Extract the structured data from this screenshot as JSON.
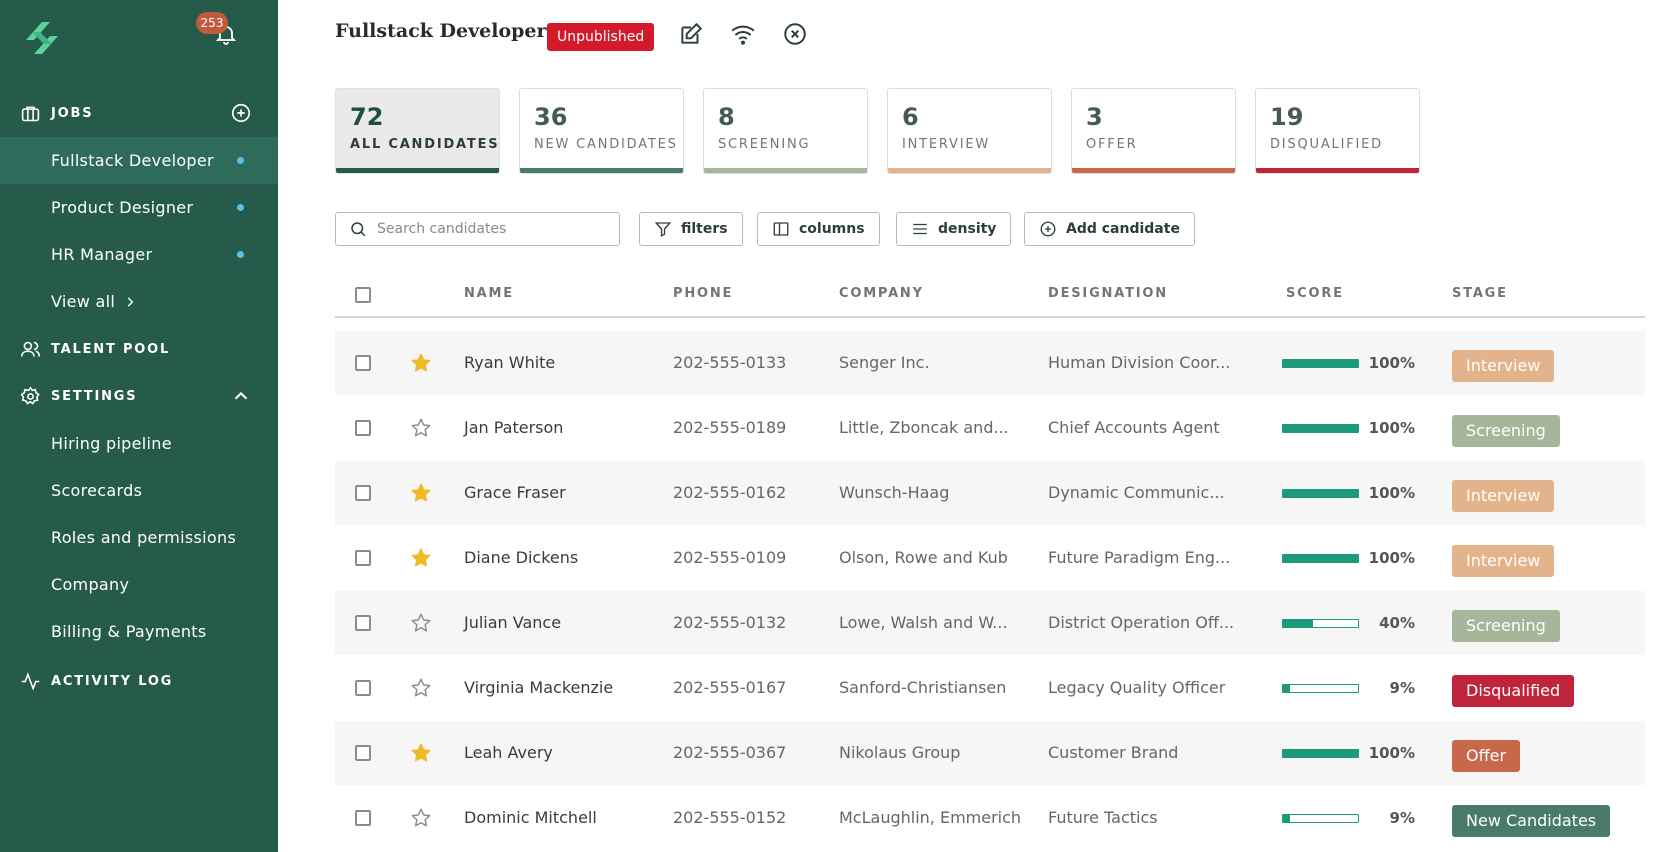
{
  "sidebar": {
    "notification_count": "253",
    "jobs_label": "JOBS",
    "jobs": [
      {
        "label": "Fullstack Developer",
        "active": true
      },
      {
        "label": "Product Designer",
        "active": false
      },
      {
        "label": "HR Manager",
        "active": false
      }
    ],
    "view_all": "View all",
    "talent_pool": "TALENT POOL",
    "settings_label": "SETTINGS",
    "settings_items": [
      "Hiring pipeline",
      "Scorecards",
      "Roles and permissions",
      "Company",
      "Billing & Payments"
    ],
    "activity_log": "ACTIVITY LOG"
  },
  "header": {
    "title": "Fullstack Developer",
    "status": "Unpublished"
  },
  "stages": [
    {
      "count": "72",
      "label": "ALL CANDIDATES",
      "color": "#265b4c",
      "active": true
    },
    {
      "count": "36",
      "label": "NEW CANDIDATES",
      "color": "#4a7a6a",
      "active": false
    },
    {
      "count": "8",
      "label": "SCREENING",
      "color": "#a5b69a",
      "active": false
    },
    {
      "count": "6",
      "label": "INTERVIEW",
      "color": "#e3b48c",
      "active": false
    },
    {
      "count": "3",
      "label": "OFFER",
      "color": "#c8684a",
      "active": false
    },
    {
      "count": "19",
      "label": "DISQUALIFIED",
      "color": "#c0243a",
      "active": false
    }
  ],
  "toolbar": {
    "search_placeholder": "Search candidates",
    "filters": "filters",
    "columns": "columns",
    "density": "density",
    "add_candidate": "Add candidate"
  },
  "table": {
    "headers": {
      "name": "NAME",
      "phone": "PHONE",
      "company": "COMPANY",
      "designation": "DESIGNATION",
      "score": "SCORE",
      "stage": "STAGE"
    },
    "rows": [
      {
        "starred": true,
        "name": "Ryan White",
        "phone": "202-555-0133",
        "company": "Senger Inc.",
        "designation": "Human Division Coor...",
        "score": 100,
        "score_label": "100%",
        "stage": "Interview",
        "stage_color": "#e3b48c"
      },
      {
        "starred": false,
        "name": "Jan Paterson",
        "phone": "202-555-0189",
        "company": "Little, Zboncak and...",
        "designation": "Chief Accounts Agent",
        "score": 100,
        "score_label": "100%",
        "stage": "Screening",
        "stage_color": "#a5b69a"
      },
      {
        "starred": true,
        "name": "Grace Fraser",
        "phone": "202-555-0162",
        "company": "Wunsch-Haag",
        "designation": "Dynamic Communic...",
        "score": 100,
        "score_label": "100%",
        "stage": "Interview",
        "stage_color": "#e3b48c"
      },
      {
        "starred": true,
        "name": "Diane Dickens",
        "phone": "202-555-0109",
        "company": "Olson, Rowe and Kub",
        "designation": "Future Paradigm Eng...",
        "score": 100,
        "score_label": "100%",
        "stage": "Interview",
        "stage_color": "#e3b48c"
      },
      {
        "starred": false,
        "name": "Julian Vance",
        "phone": "202-555-0132",
        "company": "Lowe, Walsh and W...",
        "designation": "District Operation Off...",
        "score": 40,
        "score_label": "40%",
        "stage": "Screening",
        "stage_color": "#a5b69a"
      },
      {
        "starred": false,
        "name": "Virginia Mackenzie",
        "phone": "202-555-0167",
        "company": "Sanford-Christiansen",
        "designation": "Legacy Quality Officer",
        "score": 9,
        "score_label": "9%",
        "stage": "Disqualified",
        "stage_color": "#c0243a"
      },
      {
        "starred": true,
        "name": "Leah Avery",
        "phone": "202-555-0367",
        "company": "Nikolaus Group",
        "designation": "Customer Brand",
        "score": 100,
        "score_label": "100%",
        "stage": "Offer",
        "stage_color": "#c8684a"
      },
      {
        "starred": false,
        "name": "Dominic Mitchell",
        "phone": "202-555-0152",
        "company": "McLaughlin, Emmerich",
        "designation": "Future Tactics",
        "score": 9,
        "score_label": "9%",
        "stage": "New Candidates",
        "stage_color": "#4a7a6a"
      }
    ]
  },
  "colors": {
    "sidebar_bg": "#265b4c",
    "accent": "#1c9a7a",
    "star": "#f2b927",
    "danger": "#d41a2a"
  }
}
